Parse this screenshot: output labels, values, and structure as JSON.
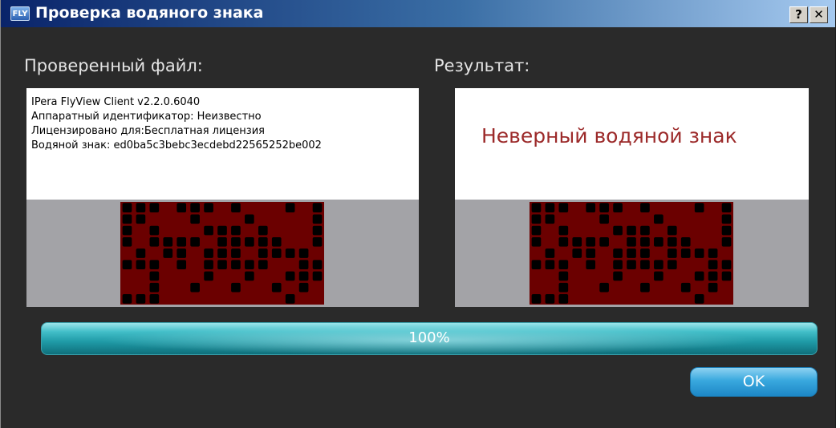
{
  "window": {
    "title": "Проверка водяного знака",
    "icon": "flyview-app-icon",
    "icon_text": "FLY",
    "help_button": "?",
    "close_button": "✕"
  },
  "left": {
    "label": "Проверенный файл:",
    "lines": [
      "IPera FlyView Client v2.2.0.6040",
      "Аппаратный идентификатор: Неизвестно",
      "Лицензировано для:Бесплатная лицензия",
      "Водяной знак: ed0ba5c3bebc3ecdebd22565252be002"
    ]
  },
  "right": {
    "label": "Результат:",
    "result_text": "Неверный водяной знак"
  },
  "watermark": {
    "bg_color": "#6b0000",
    "dot_color": "#000000",
    "rows": [
      "111011101000101",
      "110001000100001",
      "101000111010001",
      "101111011111001",
      "010110111011110",
      "111010111110011",
      "001000100100111",
      "001001001001010",
      "111000000000100"
    ]
  },
  "progress": {
    "value": 100,
    "label": "100%"
  },
  "ok_button": "OK",
  "colors": {
    "title_start": "#0a246a",
    "title_end": "#a6caf0",
    "body_bg": "#2a2a2a",
    "result_text": "#9c2a2a",
    "accent": "#39a8de"
  }
}
